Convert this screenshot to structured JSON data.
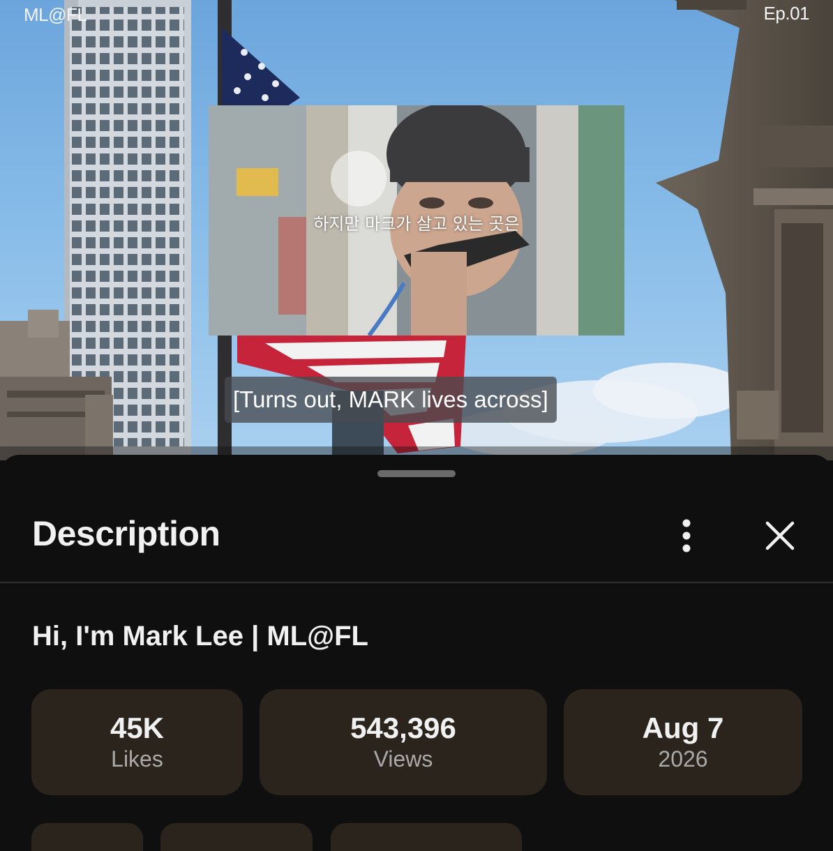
{
  "video": {
    "channel_tag": "ML@FL",
    "episode_tag": "Ep.01",
    "inset_subtitle": "하지만 마크가 살고 있는 곳은",
    "caption": "[Turns out, MARK lives across]"
  },
  "sheet": {
    "title": "Description",
    "more_icon": "more-vertical-icon",
    "close_icon": "close-icon",
    "video_title": "Hi, I'm Mark Lee | ML@FL",
    "stats": {
      "likes": {
        "value": "45K",
        "label": "Likes"
      },
      "views": {
        "value": "543,396",
        "label": "Views"
      },
      "date": {
        "value": "Aug 7",
        "label": "2026"
      }
    }
  },
  "colors": {
    "sheet_bg": "#0f0f0f",
    "card_bg": "#2a241d",
    "primary_text": "#f1f1f1",
    "secondary_text": "#aaaaaa"
  }
}
